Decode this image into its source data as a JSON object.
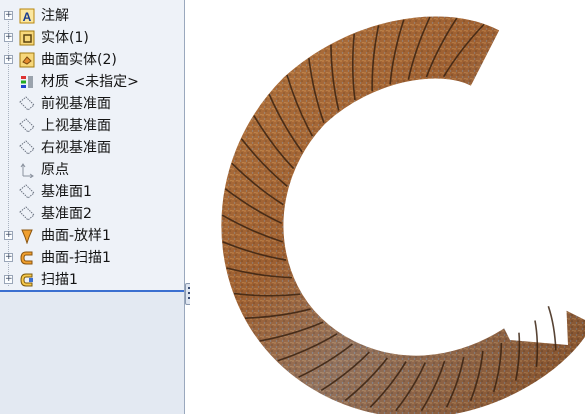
{
  "feature_tree": {
    "items": [
      {
        "label": "注解",
        "icon": "annotation-icon",
        "expandable": true
      },
      {
        "label": "实体(1)",
        "icon": "solid-body-icon",
        "expandable": true
      },
      {
        "label": "曲面实体(2)",
        "icon": "surface-body-icon",
        "expandable": true
      },
      {
        "label": "材质 <未指定>",
        "icon": "material-icon",
        "expandable": false
      },
      {
        "label": "前视基准面",
        "icon": "plane-icon",
        "expandable": false
      },
      {
        "label": "上视基准面",
        "icon": "plane-icon",
        "expandable": false
      },
      {
        "label": "右视基准面",
        "icon": "plane-icon",
        "expandable": false
      },
      {
        "label": "原点",
        "icon": "origin-icon",
        "expandable": false
      },
      {
        "label": "基准面1",
        "icon": "plane-icon",
        "expandable": false
      },
      {
        "label": "基准面2",
        "icon": "plane-icon",
        "expandable": false
      },
      {
        "label": "曲面-放样1",
        "icon": "loft-surface-icon",
        "expandable": true
      },
      {
        "label": "曲面-扫描1",
        "icon": "sweep-surface-icon",
        "expandable": true
      },
      {
        "label": "扫描1",
        "icon": "sweep-icon",
        "expandable": true
      }
    ],
    "expander_symbol": "+"
  },
  "viewport": {
    "model": "twisted-rope-c-shape",
    "colors": {
      "rust_dark": "#5a3418",
      "rust_mid": "#9a5a2a",
      "rust_light": "#c98a4a",
      "steel_blue": "#7c8fa6",
      "seam": "#3a2210"
    }
  }
}
